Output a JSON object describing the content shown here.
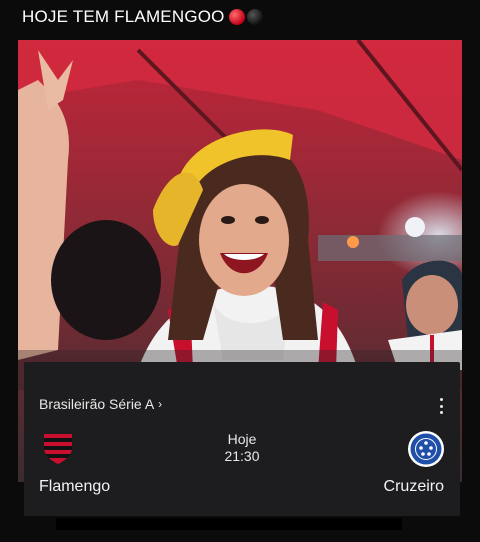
{
  "post": {
    "caption": "HOJE TEM FLAMENGOO",
    "emoji": [
      "red-circle",
      "black-circle"
    ]
  },
  "media": {
    "description_icon": "photo-of-fan-cheering"
  },
  "match_card": {
    "competition": "Brasileirão Série A",
    "competition_chevron": "›",
    "menu_icon": "kebab-menu-icon",
    "day": "Hoje",
    "time": "21:30",
    "home_team": {
      "name": "Flamengo",
      "crest": "flamengo-crest-icon"
    },
    "away_team": {
      "name": "Cruzeiro",
      "crest": "cruzeiro-crest-icon"
    }
  },
  "colors": {
    "flamengo_red": "#c8102e",
    "flamengo_black": "#111111",
    "cruzeiro_blue": "#1f4fa8",
    "card_bg": "#1d1d1f"
  }
}
